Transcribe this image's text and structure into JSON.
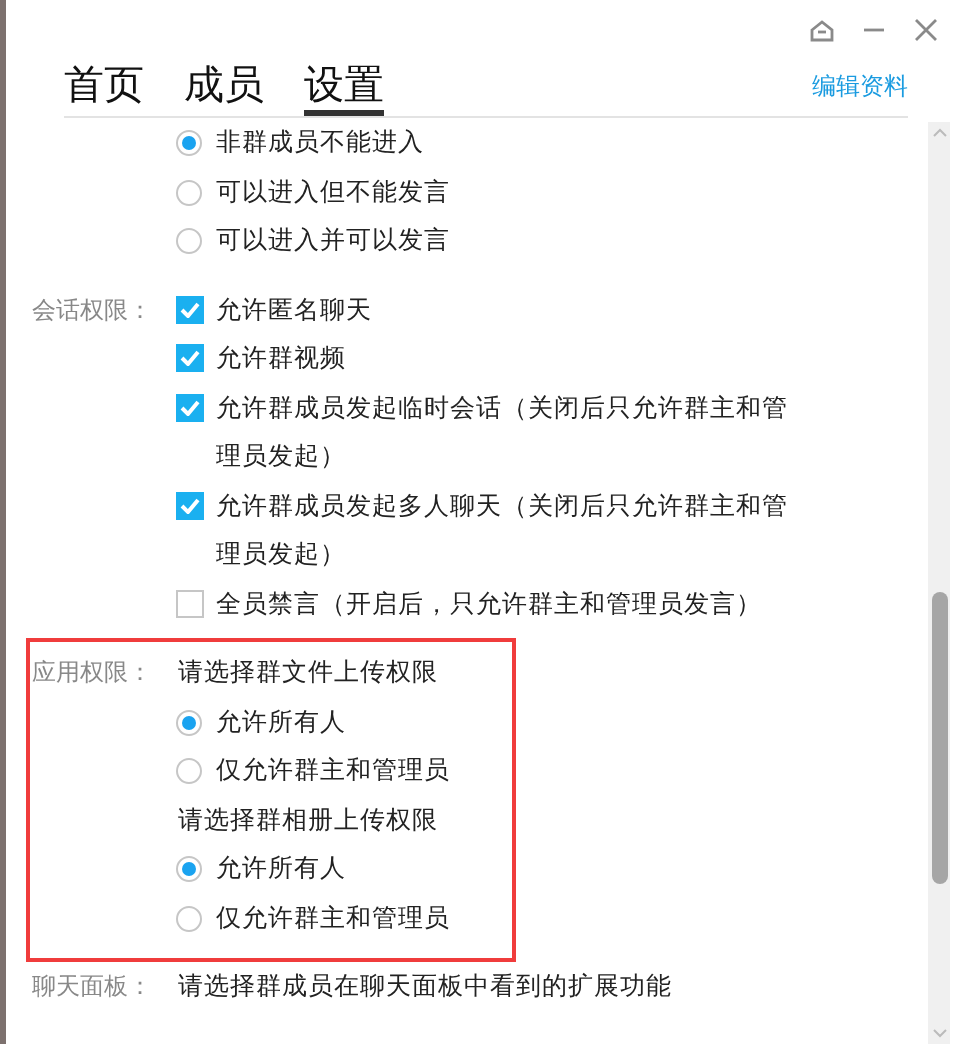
{
  "tabs": [
    {
      "label": "首页",
      "selected": false
    },
    {
      "label": "成员",
      "selected": false
    },
    {
      "label": "设置",
      "selected": true
    }
  ],
  "edit_link": "编辑资料",
  "sections": [
    {
      "items": [
        {
          "kind": "radio",
          "text": "非群成员不能进入",
          "selected": true
        },
        {
          "kind": "radio",
          "text": "可以进入但不能发言",
          "selected": false
        },
        {
          "kind": "radio",
          "text": "可以进入并可以发言",
          "selected": false
        }
      ]
    },
    {
      "label": "会话权限：",
      "items": [
        {
          "kind": "checkbox",
          "text": "允许匿名聊天",
          "checked": true
        },
        {
          "kind": "checkbox",
          "text": "允许群视频",
          "checked": true
        },
        {
          "kind": "checkbox",
          "text": "允许群成员发起临时会话（关闭后只允许群主和管理员发起）",
          "checked": true
        },
        {
          "kind": "checkbox",
          "text": "允许群成员发起多人聊天（关闭后只允许群主和管理员发起）",
          "checked": true
        },
        {
          "kind": "checkbox",
          "text": "全员禁言（开启后，只允许群主和管理员发言）",
          "checked": false
        }
      ]
    },
    {
      "label": "应用权限：",
      "highlighted": true,
      "items": [
        {
          "kind": "prompt",
          "text": "请选择群文件上传权限"
        },
        {
          "kind": "radio",
          "text": "允许所有人",
          "selected": true
        },
        {
          "kind": "radio",
          "text": "仅允许群主和管理员",
          "selected": false
        },
        {
          "kind": "prompt",
          "text": "请选择群相册上传权限"
        },
        {
          "kind": "radio",
          "text": "允许所有人",
          "selected": true
        },
        {
          "kind": "radio",
          "text": "仅允许群主和管理员",
          "selected": false
        }
      ]
    },
    {
      "label": "聊天面板：",
      "items": [
        {
          "kind": "prompt",
          "text": "请选择群成员在聊天面板中看到的扩展功能"
        }
      ]
    }
  ]
}
